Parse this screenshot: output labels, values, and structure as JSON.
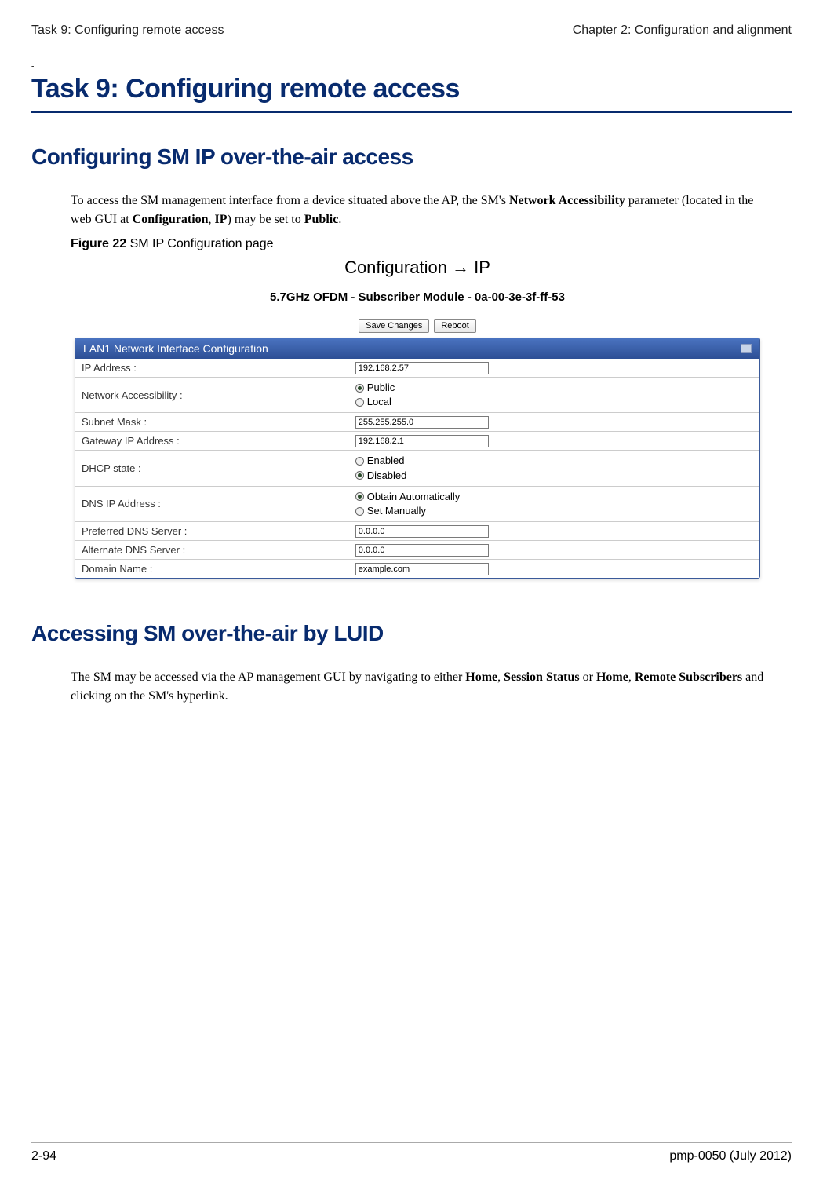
{
  "header": {
    "left": "Task 9: Configuring remote access",
    "right": "Chapter 2:  Configuration and alignment"
  },
  "dash": "-",
  "task_title": "Task 9: Configuring remote access",
  "section1": {
    "title": "Configuring SM IP over-the-air access",
    "para_parts": {
      "p1": "To access the SM management interface from a device situated above the AP, the SM's ",
      "b1": "Network Accessibility",
      "p2": " parameter (located in the web GUI at ",
      "b2": "Configuration",
      "p3": ", ",
      "b3": "IP",
      "p4": ") may be set to ",
      "b4": "Public",
      "p5": "."
    },
    "figure_label_bold": "Figure 22",
    "figure_label_rest": "  SM IP Configuration page"
  },
  "figure": {
    "breadcrumb": "Configuration → IP",
    "subtitle": "5.7GHz OFDM - Subscriber Module - 0a-00-3e-3f-ff-53",
    "buttons": {
      "save": "Save Changes",
      "reboot": "Reboot"
    },
    "panel_title": "LAN1 Network Interface Configuration",
    "rows": {
      "ip_addr": {
        "label": "IP Address :",
        "value": "192.168.2.57"
      },
      "net_acc": {
        "label": "Network Accessibility :",
        "opt1": "Public",
        "opt2": "Local"
      },
      "subnet": {
        "label": "Subnet Mask :",
        "value": "255.255.255.0"
      },
      "gateway": {
        "label": "Gateway IP Address :",
        "value": "192.168.2.1"
      },
      "dhcp": {
        "label": "DHCP state :",
        "opt1": "Enabled",
        "opt2": "Disabled"
      },
      "dns_ip": {
        "label": "DNS IP Address :",
        "opt1": "Obtain Automatically",
        "opt2": "Set Manually"
      },
      "pref_dns": {
        "label": "Preferred DNS Server :",
        "value": "0.0.0.0"
      },
      "alt_dns": {
        "label": "Alternate DNS Server :",
        "value": "0.0.0.0"
      },
      "domain": {
        "label": "Domain Name :",
        "value": "example.com"
      }
    }
  },
  "section2": {
    "title": "Accessing SM over-the-air by LUID",
    "para_parts": {
      "p1": "The SM may be accessed via the AP management GUI by navigating to either ",
      "b1": "Home",
      "p2": ", ",
      "b2": "Session Status",
      "p3": " or ",
      "b3": "Home",
      "p4": ", ",
      "b4": "Remote Subscribers",
      "p5": " and clicking on the SM's hyperlink."
    }
  },
  "footer": {
    "left": "2-94",
    "right": "pmp-0050 (July 2012)"
  }
}
